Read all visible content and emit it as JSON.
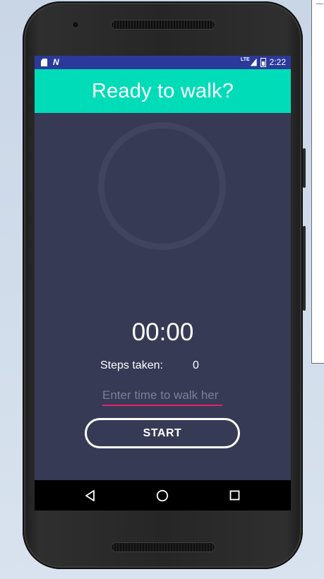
{
  "status_bar": {
    "left_icons": [
      "sd-card-icon",
      "n-notification-icon"
    ],
    "network": "LTE",
    "right_icons": [
      "signal-icon",
      "battery-icon"
    ],
    "time": "2:22"
  },
  "app_bar": {
    "title": "Ready to walk?"
  },
  "progress": {
    "value": 0
  },
  "timer": {
    "display": "00:00"
  },
  "steps": {
    "label": "Steps taken:",
    "value": "0"
  },
  "time_input": {
    "placeholder": "Enter time to walk her",
    "value": ""
  },
  "start_button": {
    "label": "START"
  },
  "nav_bar": {
    "icons": [
      "back-icon",
      "home-icon",
      "recents-icon"
    ]
  },
  "colors": {
    "app_bar": "#00dcb8",
    "background": "#363a55",
    "status_bar": "#2b3a9a",
    "input_underline": "#e0246e"
  }
}
